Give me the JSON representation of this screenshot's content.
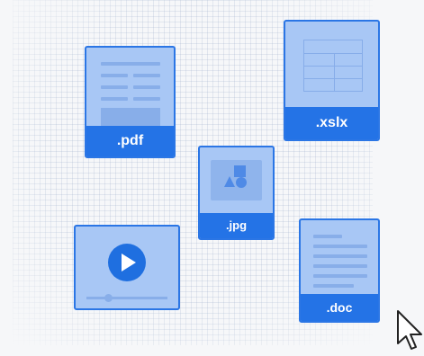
{
  "files": {
    "pdf": {
      "label": ".pdf"
    },
    "xlsx": {
      "label": ".xslx"
    },
    "jpg": {
      "label": ".jpg"
    },
    "doc": {
      "label": ".doc"
    },
    "video": {}
  },
  "colors": {
    "card_fill": "#a8c7f5",
    "card_border": "#2b76e5",
    "label_fill": "#2473e6",
    "label_text": "#ffffff",
    "background": "#f6f7f9"
  },
  "icons": [
    "play-icon",
    "image-placeholder-icon",
    "mouse-cursor-icon"
  ]
}
